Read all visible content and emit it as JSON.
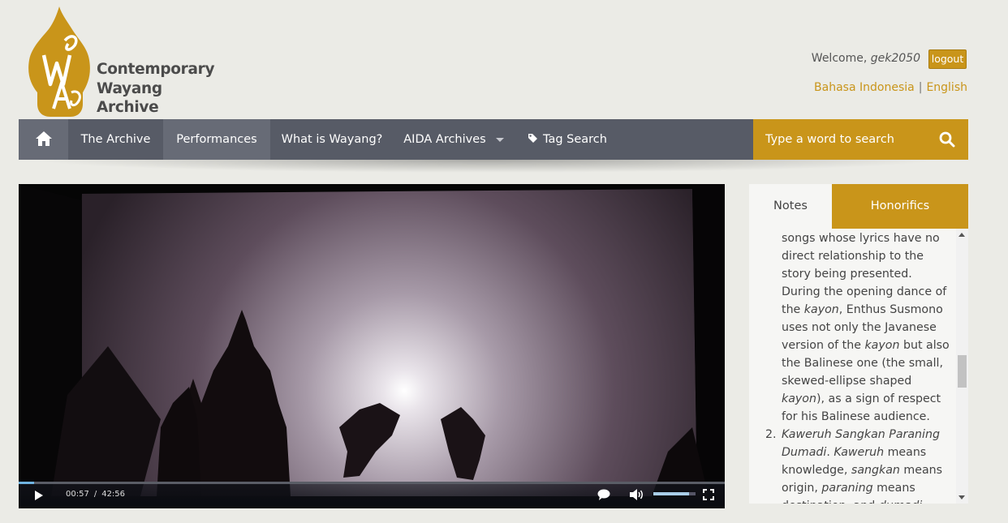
{
  "logo": {
    "line1": "Contemporary",
    "line2": "Wayang",
    "line3": "Archive",
    "emblem_icon": "wayang-kayon-icon",
    "brand_color": "#c9951a"
  },
  "user": {
    "welcome_prefix": "Welcome, ",
    "username": "gek2050",
    "logout_label": "logout"
  },
  "languages": {
    "indonesian": "Bahasa Indonesia",
    "separator": "|",
    "english": "English"
  },
  "nav": {
    "home_icon": "home-icon",
    "items": [
      {
        "label": "The Archive"
      },
      {
        "label": "Performances"
      },
      {
        "label": "What is Wayang?"
      },
      {
        "label": "AIDA Archives"
      },
      {
        "label": "Tag Search"
      }
    ],
    "search_placeholder": "Type a word to search",
    "search_icon": "search-icon"
  },
  "video": {
    "current_time": "00:57",
    "time_separator": "/",
    "duration": "42:56",
    "progress": 0.022,
    "volume_level": 0.85
  },
  "panel": {
    "tab_notes": "Notes",
    "tab_honorifics": "Honorifics",
    "p1": {
      "a": "songs whose lyrics have no direct relationship to the story being presented. During the opening dance of the ",
      "b": "kayon",
      "c": ", Enthus Susmono uses not only the Javanese version of the ",
      "d": "kayon",
      "e": " but also the Balinese one (the small, skewed-ellipse shaped ",
      "f": "kayon",
      "g": "), as a sign of respect for his Balinese audience."
    },
    "item2": {
      "num": "2.",
      "a": "Kaweruh Sangkan Paraning Dumadi",
      "b": ". ",
      "c": "Kaweruh",
      "d": " means knowledge, ",
      "e": "sangkan",
      "f": " means origin, ",
      "g": "paraning",
      "h": " means destination, and ",
      "i": "dumadi"
    }
  }
}
